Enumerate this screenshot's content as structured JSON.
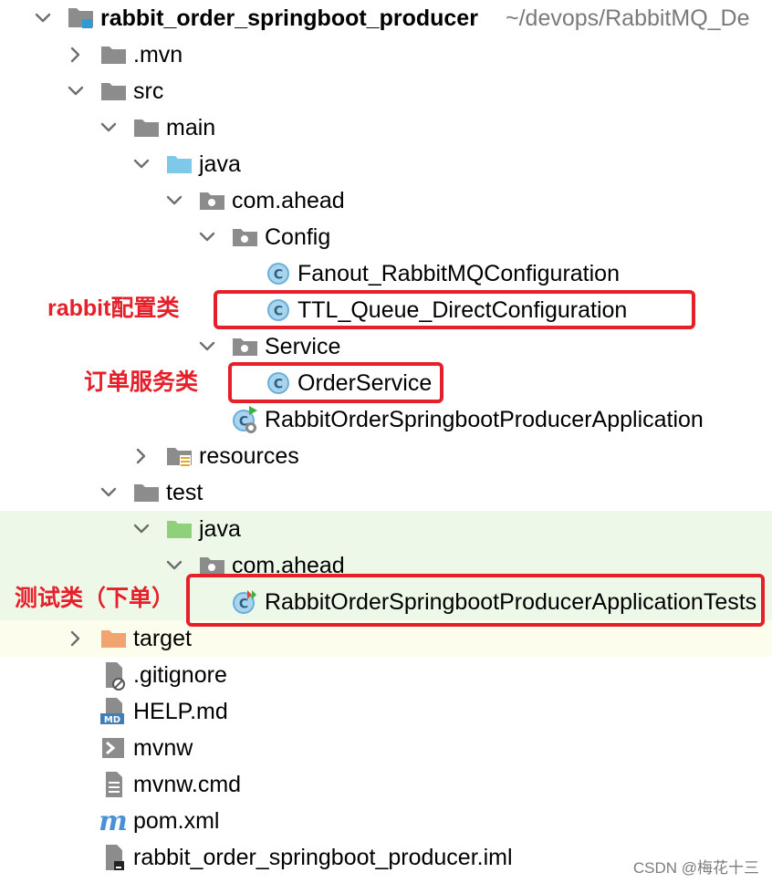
{
  "project": {
    "name": "rabbit_order_springboot_producer",
    "path": "~/devops/RabbitMQ_De"
  },
  "tree": [
    {
      "label": "rabbit_order_springboot_producer",
      "icon": "module-folder-icon",
      "arrow": "expanded"
    },
    {
      "label": ".mvn",
      "icon": "folder-icon",
      "arrow": "collapsed"
    },
    {
      "label": "src",
      "icon": "folder-icon",
      "arrow": "expanded"
    },
    {
      "label": "main",
      "icon": "folder-icon",
      "arrow": "expanded"
    },
    {
      "label": "java",
      "icon": "source-root-folder-icon",
      "arrow": "expanded"
    },
    {
      "label": "com.ahead",
      "icon": "package-icon",
      "arrow": "expanded"
    },
    {
      "label": "Config",
      "icon": "package-icon",
      "arrow": "expanded"
    },
    {
      "label": "Fanout_RabbitMQConfiguration",
      "icon": "java-class-icon",
      "arrow": "none"
    },
    {
      "label": "TTL_Queue_DirectConfiguration",
      "icon": "java-class-icon",
      "arrow": "none"
    },
    {
      "label": "Service",
      "icon": "package-icon",
      "arrow": "expanded"
    },
    {
      "label": "OrderService",
      "icon": "java-class-icon",
      "arrow": "none"
    },
    {
      "label": "RabbitOrderSpringbootProducerApplication",
      "icon": "spring-boot-class-icon",
      "arrow": "none"
    },
    {
      "label": "resources",
      "icon": "resources-folder-icon",
      "arrow": "collapsed"
    },
    {
      "label": "test",
      "icon": "folder-icon",
      "arrow": "expanded"
    },
    {
      "label": "java",
      "icon": "test-root-folder-icon",
      "arrow": "expanded"
    },
    {
      "label": "com.ahead",
      "icon": "package-icon",
      "arrow": "expanded"
    },
    {
      "label": "RabbitOrderSpringbootProducerApplicationTests",
      "icon": "test-class-icon",
      "arrow": "none"
    },
    {
      "label": "target",
      "icon": "excluded-folder-icon",
      "arrow": "collapsed"
    },
    {
      "label": ".gitignore",
      "icon": "ignored-file-icon",
      "arrow": "none"
    },
    {
      "label": "HELP.md",
      "icon": "markdown-file-icon",
      "arrow": "none"
    },
    {
      "label": "mvnw",
      "icon": "shell-script-icon",
      "arrow": "none"
    },
    {
      "label": "mvnw.cmd",
      "icon": "text-file-icon",
      "arrow": "none"
    },
    {
      "label": "pom.xml",
      "icon": "maven-icon",
      "arrow": "none"
    },
    {
      "label": "rabbit_order_springboot_producer.iml",
      "icon": "iml-file-icon",
      "arrow": "none"
    }
  ],
  "annotations": {
    "rabbit_config": "rabbit配置类",
    "order_service": "订单服务类",
    "test_class": "测试类（下单）"
  },
  "watermark": "CSDN @梅花十三",
  "colors": {
    "annotation_red": "#e5202a",
    "test_highlight": "#eef8e8",
    "target_highlight": "#fdfdee",
    "folder_gray": "#8c8c8c",
    "source_root_blue": "#7ec8e8",
    "test_root_green": "#8fd07a",
    "excluded_orange": "#f2a470",
    "class_icon_blue": "#6aaedb",
    "maven_blue": "#4a90d9"
  }
}
